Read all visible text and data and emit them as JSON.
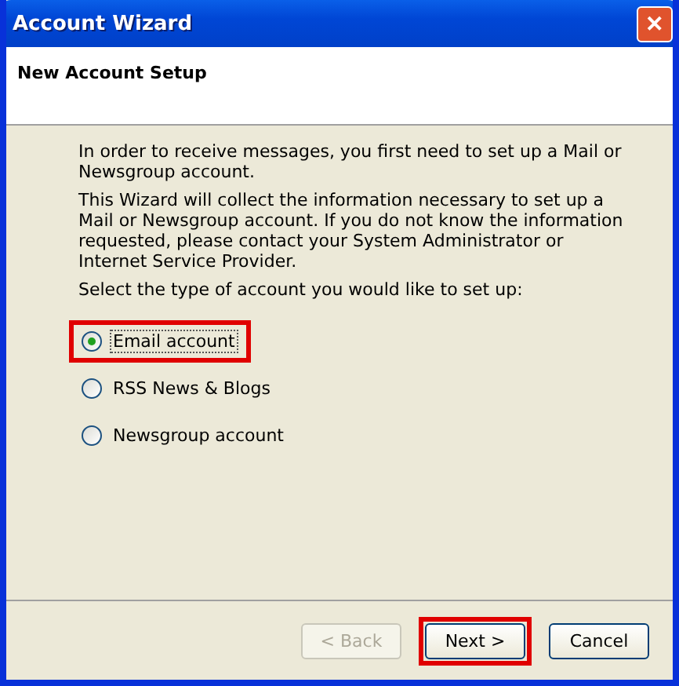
{
  "window": {
    "title": "Account Wizard",
    "close_label": "✕"
  },
  "header": {
    "title": "New Account Setup"
  },
  "paragraphs": [
    "In order to receive messages, you first need to set up a Mail or Newsgroup account.",
    "This Wizard will collect the information necessary to set up a Mail or Newsgroup account. If you do not know the information requested, please contact your System Administrator or Internet Service Provider.",
    "Select the type of account you would like to set up:"
  ],
  "options": [
    {
      "label": "Email account",
      "selected": true,
      "highlighted": true
    },
    {
      "label": "RSS News & Blogs",
      "selected": false,
      "highlighted": false
    },
    {
      "label": "Newsgroup account",
      "selected": false,
      "highlighted": false
    }
  ],
  "buttons": [
    {
      "label": "< Back",
      "disabled": true,
      "highlighted": false
    },
    {
      "label": "Next >",
      "disabled": false,
      "highlighted": true
    },
    {
      "label": "Cancel",
      "disabled": false,
      "highlighted": false
    }
  ]
}
